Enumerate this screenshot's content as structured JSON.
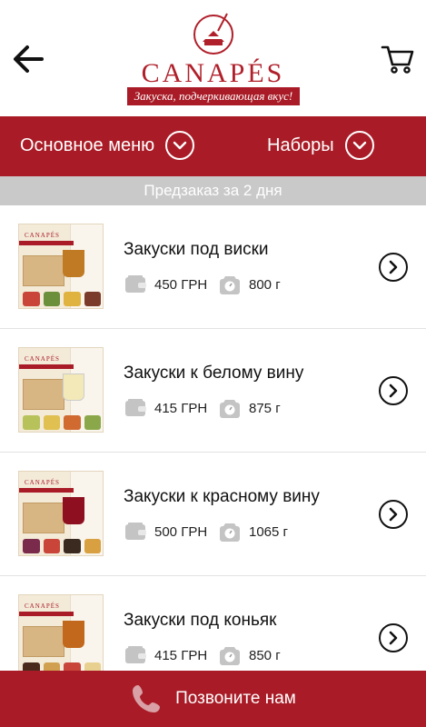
{
  "header": {
    "logo_text": "CANAPÉS",
    "tagline": "Закуска, подчеркивающая вкус!",
    "back_icon": "arrow-left-icon",
    "cart_icon": "cart-icon"
  },
  "nav": {
    "main_label": "Основное меню",
    "sets_label": "Наборы"
  },
  "preorder": "Предзаказ за 2 дня",
  "items": [
    {
      "title": "Закуски под виски",
      "price": "450 ГРН",
      "weight": "800 г",
      "drink_color": "#c07a24"
    },
    {
      "title": "Закуски к белому вину",
      "price": "415 ГРН",
      "weight": "875 г",
      "drink_color": "#f3e9b8"
    },
    {
      "title": "Закуски к красному вину",
      "price": "500 ГРН",
      "weight": "1065 г",
      "drink_color": "#8e1020"
    },
    {
      "title": "Закуски под коньяк",
      "price": "415 ГРН",
      "weight": "850 г",
      "drink_color": "#c2681c"
    }
  ],
  "callbar": {
    "label": "Позвоните нам",
    "icon": "phone-icon"
  },
  "colors": {
    "brand": "#a91c27",
    "preorder_bg": "#c9c9c9"
  }
}
